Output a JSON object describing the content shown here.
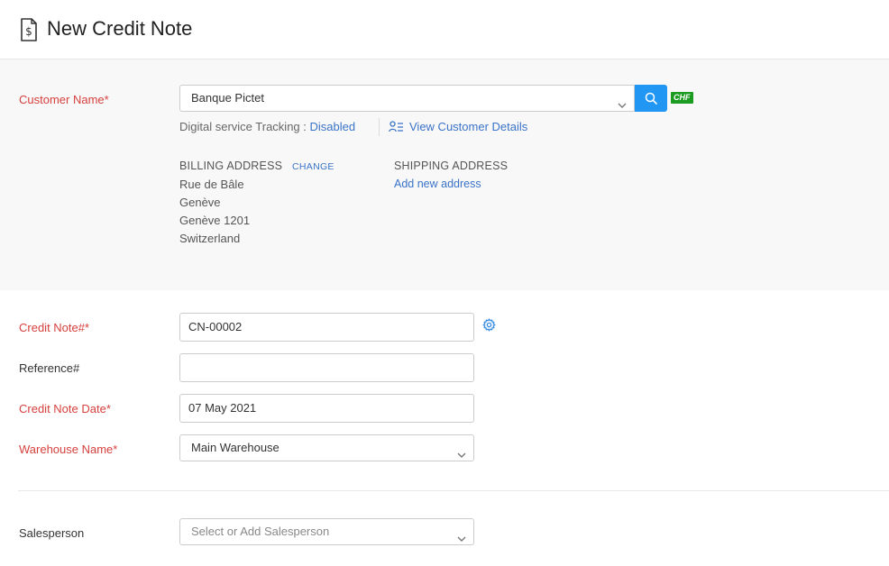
{
  "header": {
    "title": "New Credit Note",
    "icon": "credit-note-doc-icon"
  },
  "customer": {
    "label": "Customer Name*",
    "value": "Banque Pictet",
    "currency": "CHF",
    "tracking_label": "Digital service Tracking : ",
    "tracking_value": "Disabled",
    "view_details": "View Customer Details",
    "billing": {
      "heading": "BILLING ADDRESS",
      "change": "CHANGE",
      "lines": [
        "Rue de Bâle",
        "Genève",
        "Genève 1201",
        "Switzerland"
      ]
    },
    "shipping": {
      "heading": "SHIPPING ADDRESS",
      "add": "Add new address"
    }
  },
  "fields": {
    "credit_note_label": "Credit Note#*",
    "credit_note_value": "CN-00002",
    "reference_label": "Reference#",
    "reference_value": "",
    "date_label": "Credit Note Date*",
    "date_value": "07 May 2021",
    "warehouse_label": "Warehouse Name*",
    "warehouse_value": "Main Warehouse",
    "salesperson_label": "Salesperson",
    "salesperson_placeholder": "Select or Add Salesperson"
  },
  "colors": {
    "required": "#d6403d",
    "link": "#3a73c8",
    "primary": "#2196f3",
    "currency_badge": "#1b9b1f"
  }
}
